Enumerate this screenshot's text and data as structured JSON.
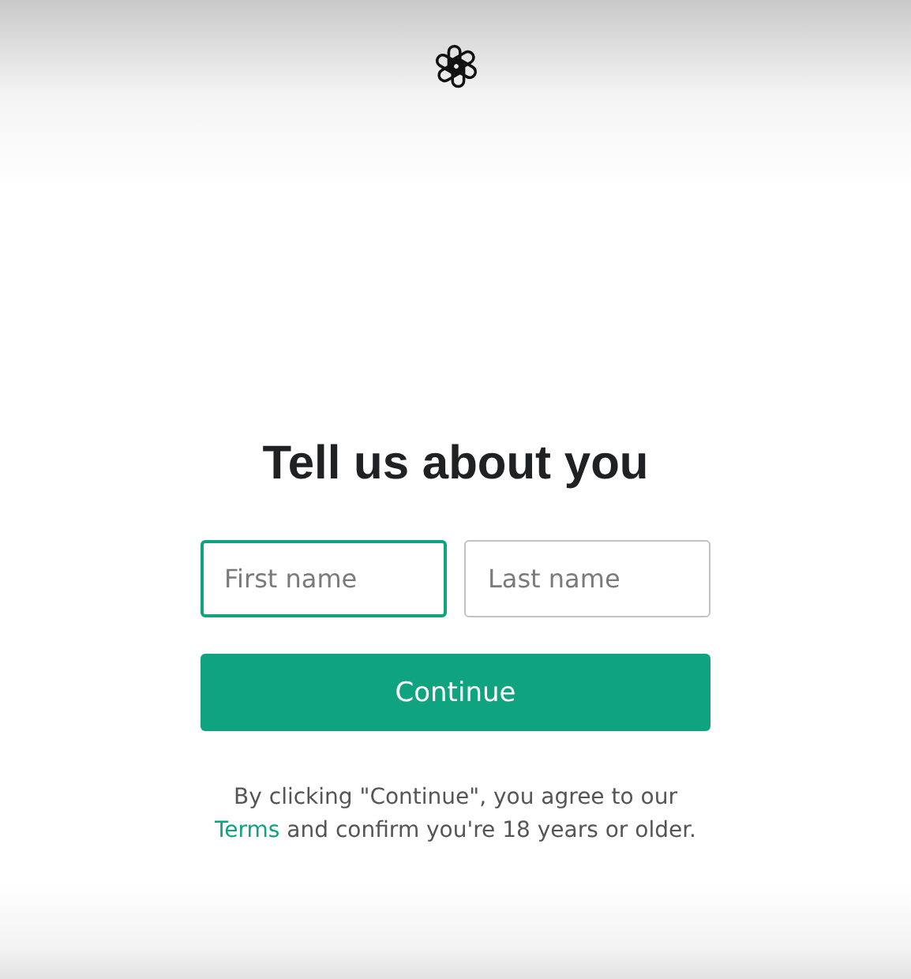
{
  "title": "Tell us about you",
  "fields": [
    {
      "placeholder": "First name",
      "focused": true
    },
    {
      "placeholder": "Last name",
      "focused": false
    }
  ],
  "button": "Continue",
  "legal": {
    "before": "By clicking \"Continue\", you agree to our ",
    "link": "Terms",
    "after": " and confirm you're 18 years or older."
  }
}
